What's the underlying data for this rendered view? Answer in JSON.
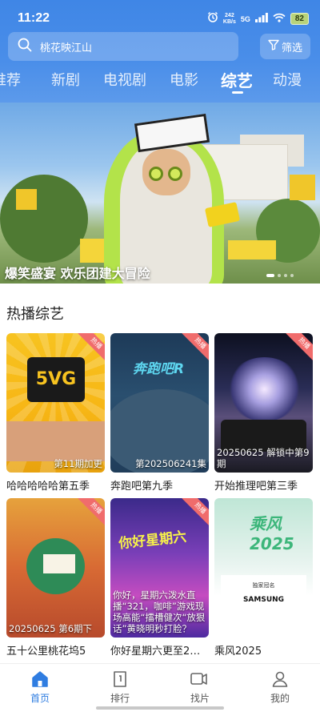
{
  "status": {
    "time": "11:22",
    "net_speed_value": "242",
    "net_speed_unit": "KB/s",
    "network": "5G",
    "battery": "82"
  },
  "search": {
    "query": "桃花映江山",
    "filter_label": "筛选"
  },
  "tabs": [
    {
      "label": "推荐"
    },
    {
      "label": "新剧"
    },
    {
      "label": "电视剧"
    },
    {
      "label": "电影"
    },
    {
      "label": "综艺",
      "active": true
    },
    {
      "label": "动漫"
    }
  ],
  "banner": {
    "caption": "爆笑盛宴 欢乐团建大冒险"
  },
  "section": {
    "title": "热播综艺"
  },
  "cards": [
    {
      "title": "哈哈哈哈哈第五季",
      "overlay": "第11期加更",
      "tag": "热播"
    },
    {
      "title": "奔跑吧第九季",
      "overlay": "第202506241集",
      "tag": "热播"
    },
    {
      "title": "开始推理吧第三季",
      "overlay": "20250625 解锁中第9期",
      "tag": "热播"
    },
    {
      "title": "五十公里桃花坞5",
      "overlay": "20250625 第6期下",
      "tag": "热播"
    },
    {
      "title": "你好星期六更至2…",
      "overlay": "你好，星期六泼水直播“321，咖啡”游戏现场高能“擂槽健次“放狠话”黄晓明秒打脸？",
      "tag": "热播"
    },
    {
      "title": "乘风2025",
      "overlay": "",
      "tag": ""
    }
  ],
  "poster_text": {
    "p1_logo": "5VG",
    "p2_logo": "奔跑吧R",
    "p5_logo": "你好星期六",
    "p6_logo": "乘风2025",
    "p6_sponsor": "独家冠名",
    "p6_brand": "SAMSUNG"
  },
  "nav": [
    {
      "label": "首页",
      "icon": "home-icon",
      "active": true
    },
    {
      "label": "排行",
      "icon": "ranking-icon"
    },
    {
      "label": "找片",
      "icon": "video-search-icon"
    },
    {
      "label": "我的",
      "icon": "profile-icon"
    }
  ],
  "colors": {
    "header_blue": "#3f86e6",
    "accent": "#2f7de1",
    "hot_tag": "#f06c6c"
  }
}
